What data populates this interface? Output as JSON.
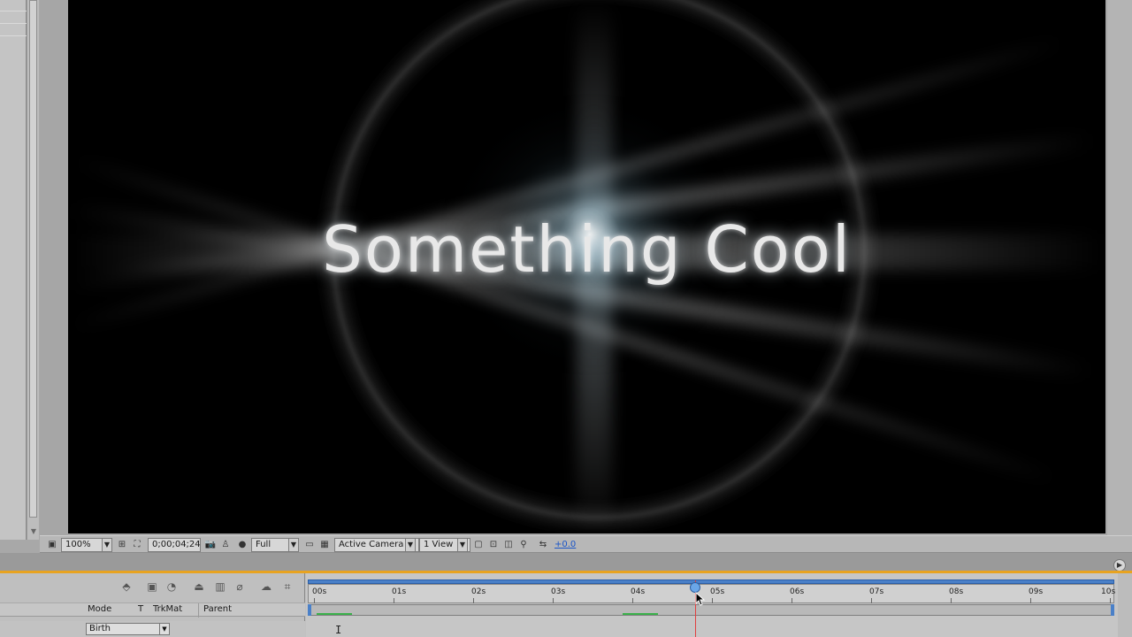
{
  "viewer": {
    "title_text": "Something Cool"
  },
  "viewer_toolbar": {
    "magnification": "100%",
    "timecode": "0;00;04;24",
    "resolution": "Full",
    "camera": "Active Camera",
    "view_layout": "1 View",
    "exposure": "+0.0"
  },
  "timeline": {
    "columns": {
      "mode": "Mode",
      "t": "T",
      "trkmat": "TrkMat",
      "parent": "Parent"
    },
    "layer_mode_value": "Birth",
    "ruler_labels": [
      "00s",
      "01s",
      "02s",
      "03s",
      "04s",
      "05s",
      "06s",
      "07s",
      "08s",
      "09s",
      "10s"
    ],
    "current_time_seconds": 4.8
  },
  "colors": {
    "timeline_tab_accent": "#e8a320",
    "playhead": "#e04040",
    "work_area": "#4a80c8",
    "keyframes": "#39b04a"
  }
}
